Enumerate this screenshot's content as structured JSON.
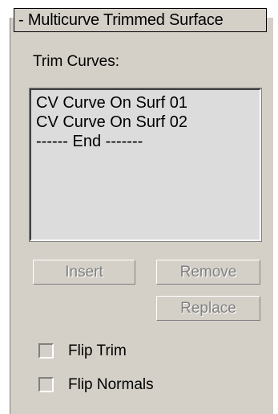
{
  "rollout": {
    "title": "- Multicurve Trimmed Surface"
  },
  "trim_curves": {
    "label": "Trim Curves:",
    "items": [
      "CV Curve On Surf 01",
      "CV Curve On Surf 02",
      "------ End -------"
    ]
  },
  "buttons": {
    "insert": "Insert",
    "remove": "Remove",
    "replace": "Replace"
  },
  "options": {
    "flip_trim": {
      "label": "Flip Trim",
      "checked": false
    },
    "flip_normals": {
      "label": "Flip Normals",
      "checked": false
    }
  },
  "colors": {
    "panel_bg": "#d4d0c8",
    "list_bg": "#dcdcdc",
    "disabled_text": "#808080"
  }
}
